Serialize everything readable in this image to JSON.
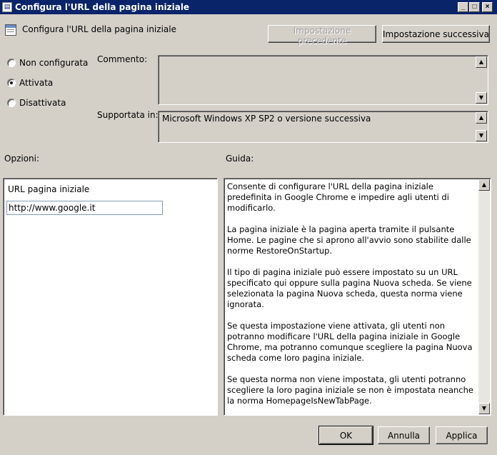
{
  "window": {
    "title": "Configura l'URL della pagina iniziale",
    "minimize": "_",
    "maximize": "□",
    "close": "×"
  },
  "header": {
    "policy_title": "Configura l'URL della pagina iniziale",
    "prev_button": "Impostazione precedente",
    "next_button": "Impostazione successiva"
  },
  "state": {
    "options": [
      {
        "label": "Non configurata",
        "selected": false
      },
      {
        "label": "Attivata",
        "selected": true
      },
      {
        "label": "Disattivata",
        "selected": false
      }
    ]
  },
  "comment": {
    "label": "Commento:",
    "value": ""
  },
  "supported": {
    "label": "Supportata in:",
    "value": "Microsoft Windows XP SP2 o versione successiva"
  },
  "options_section": {
    "label": "Opzioni:",
    "field_label": "URL pagina iniziale",
    "field_value": "http://www.google.it"
  },
  "help_section": {
    "label": "Guida:",
    "paragraphs": [
      "Consente di configurare l'URL della pagina iniziale predefinita in Google Chrome e impedire agli utenti di modificarlo.",
      "La pagina iniziale è la pagina aperta tramite il pulsante Home. Le pagine che si aprono all'avvio sono stabilite dalle norme RestoreOnStartup.",
      "Il tipo di pagina iniziale può essere impostato su un URL specificato qui oppure sulla pagina Nuova scheda. Se viene selezionata la pagina Nuova scheda, questa norma viene ignorata.",
      "Se questa impostazione viene attivata, gli utenti non potranno modificare l'URL della pagina iniziale in Google Chrome, ma potranno comunque scegliere la pagina Nuova scheda come loro pagina iniziale.",
      "Se questa norma non viene impostata, gli utenti potranno scegliere la loro pagina iniziale se non è impostata neanche la norma HomepageIsNewTabPage."
    ]
  },
  "footer": {
    "ok": "OK",
    "cancel": "Annulla",
    "apply": "Applica"
  },
  "colors": {
    "titlebar": "#0a246a",
    "dialog_bg": "#d4d0c8"
  }
}
